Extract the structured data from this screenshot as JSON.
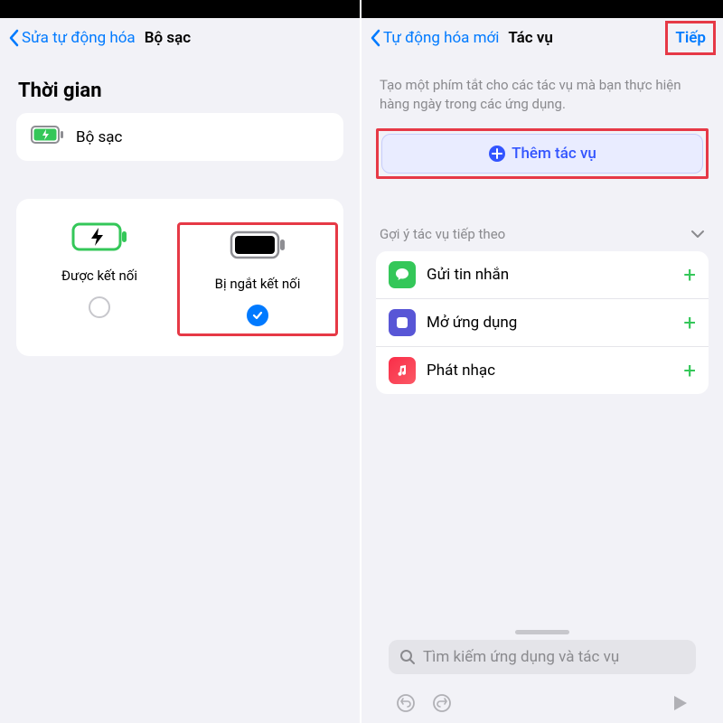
{
  "left": {
    "back_label": "Sửa tự động hóa",
    "title": "Bộ sạc",
    "section_title": "Thời gian",
    "charger_label": "Bộ sạc",
    "connected_label": "Được kết nối",
    "disconnected_label": "Bị ngắt kết nối"
  },
  "right": {
    "back_label": "Tự động hóa mới",
    "title": "Tác vụ",
    "next_label": "Tiếp",
    "description": "Tạo một phím tắt cho các tác vụ mà bạn thực hiện hàng ngày trong các ứng dụng.",
    "add_task_label": "Thêm tác vụ",
    "suggest_header": "Gợi ý tác vụ tiếp theo",
    "suggestions": {
      "messages": "Gửi tin nhắn",
      "open_app": "Mở ứng dụng",
      "play_music": "Phát nhạc"
    },
    "search_placeholder": "Tìm kiếm ứng dụng và tác vụ"
  }
}
